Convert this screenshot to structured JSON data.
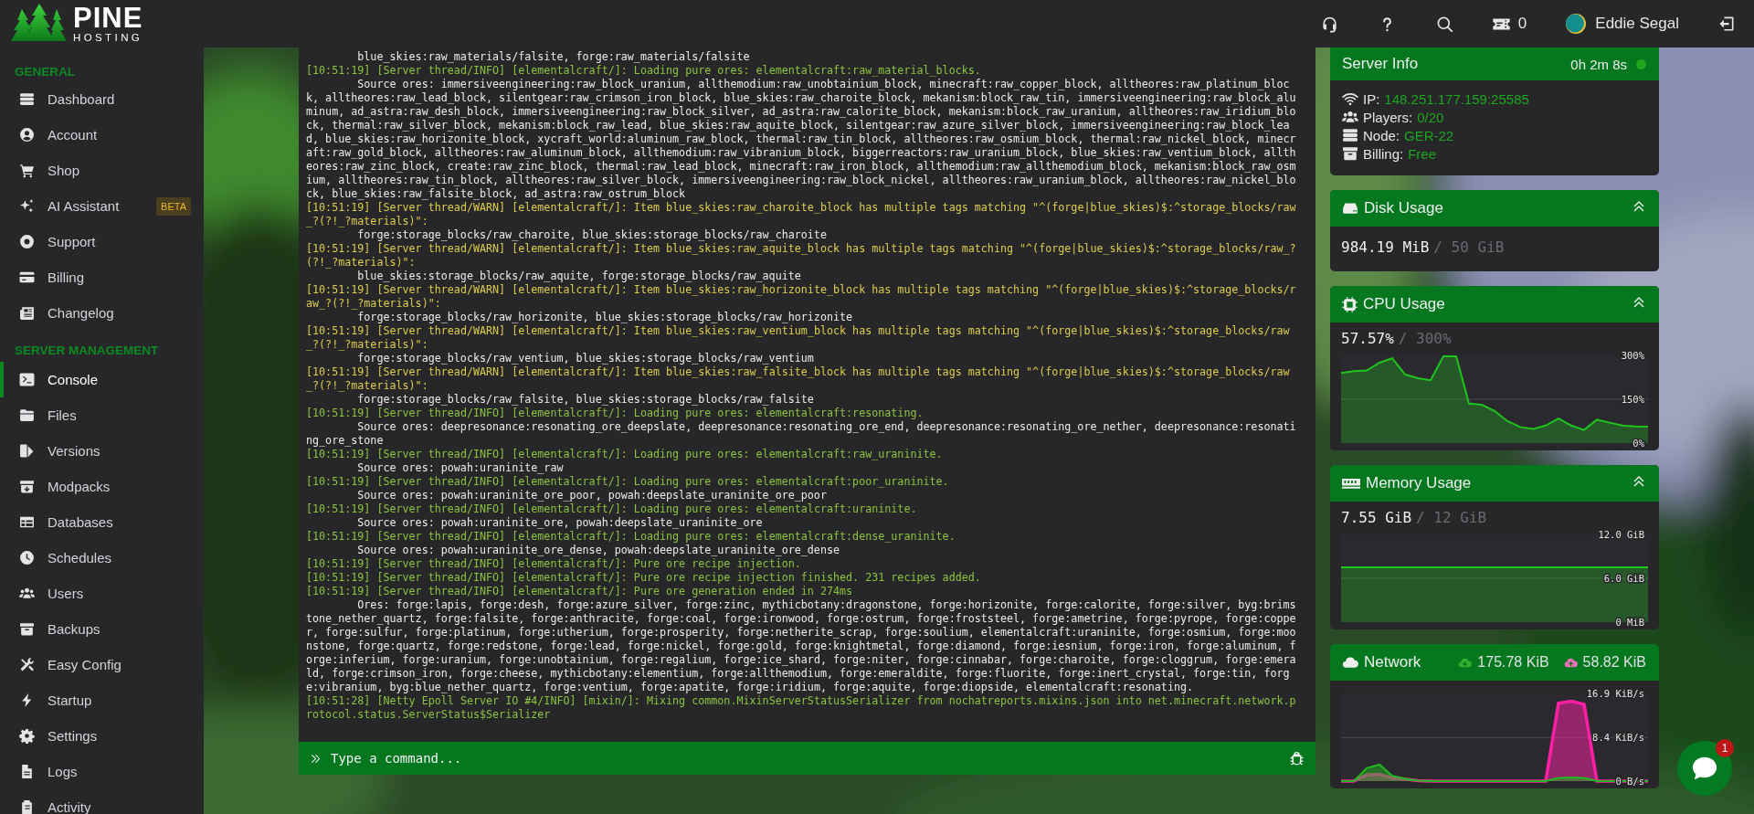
{
  "brand": {
    "name": "PINE",
    "tagline": "HOSTING"
  },
  "topbar": {
    "ticket_count": "0",
    "user_name": "Eddie Segal"
  },
  "sidebar": {
    "sections": [
      {
        "title": "GENERAL",
        "items": [
          {
            "label": "Dashboard",
            "selected": false
          },
          {
            "label": "Account",
            "selected": false
          },
          {
            "label": "Shop",
            "selected": false
          },
          {
            "label": "AI Assistant",
            "badge": "BETA",
            "selected": false
          },
          {
            "label": "Support",
            "selected": false
          },
          {
            "label": "Billing",
            "selected": false
          },
          {
            "label": "Changelog",
            "selected": false
          }
        ]
      },
      {
        "title": "SERVER MANAGEMENT",
        "items": [
          {
            "label": "Console",
            "selected": true
          },
          {
            "label": "Files",
            "selected": false
          },
          {
            "label": "Versions",
            "selected": false
          },
          {
            "label": "Modpacks",
            "selected": false
          },
          {
            "label": "Databases",
            "selected": false
          },
          {
            "label": "Schedules",
            "selected": false
          },
          {
            "label": "Users",
            "selected": false
          },
          {
            "label": "Backups",
            "selected": false
          },
          {
            "label": "Easy Config",
            "selected": false
          },
          {
            "label": "Startup",
            "selected": false
          },
          {
            "label": "Settings",
            "selected": false
          },
          {
            "label": "Logs",
            "selected": false
          },
          {
            "label": "Activity",
            "selected": false
          }
        ]
      }
    ]
  },
  "console": {
    "lines": [
      {
        "kind": "detail",
        "text": "blue_skies:raw_materials/falsite, forge:raw_materials/falsite"
      },
      {
        "kind": "info",
        "text": "[10:51:19] [Server thread/INFO] [elementalcraft/]: Loading pure ores: elementalcraft:raw_material_blocks."
      },
      {
        "kind": "detail",
        "text": "Source ores: immersiveengineering:raw_block_uranium, allthemodium:raw_unobtainium_block, minecraft:raw_copper_block, alltheores:raw_platinum_block, alltheores:raw_lead_block, silentgear:raw_crimson_iron_block, blue_skies:raw_charoite_block, mekanism:block_raw_tin, immersiveengineering:raw_block_aluminum, ad_astra:raw_desh_block, immersiveengineering:raw_block_silver, ad_astra:raw_calorite_block, mekanism:block_raw_uranium, alltheores:raw_iridium_block, thermal:raw_silver_block, mekanism:block_raw_lead, blue_skies:raw_aquite_block, silentgear:raw_azure_silver_block, immersiveengineering:raw_block_lead, blue_skies:raw_horizonite_block, xycraft_world:aluminum_raw_block, thermal:raw_tin_block, alltheores:raw_osmium_block, thermal:raw_nickel_block, minecraft:raw_gold_block, alltheores:raw_aluminum_block, allthemodium:raw_vibranium_block, biggerreactors:raw_uranium_block, blue_skies:raw_ventium_block, alltheores:raw_zinc_block, create:raw_zinc_block, thermal:raw_lead_block, minecraft:raw_iron_block, allthemodium:raw_allthemodium_block, mekanism:block_raw_osmium, alltheores:raw_tin_block, alltheores:raw_silver_block, immersiveengineering:raw_block_nickel, alltheores:raw_uranium_block, alltheores:raw_nickel_block, blue_skies:raw_falsite_block, ad_astra:raw_ostrum_block"
      },
      {
        "kind": "warn",
        "text": "[10:51:19] [Server thread/WARN] [elementalcraft/]: Item blue_skies:raw_charoite_block has multiple tags matching \"^(forge|blue_skies)$:^storage_blocks/raw_?(?!_?materials)\":"
      },
      {
        "kind": "detail",
        "text": "forge:storage_blocks/raw_charoite, blue_skies:storage_blocks/raw_charoite"
      },
      {
        "kind": "warn",
        "text": "[10:51:19] [Server thread/WARN] [elementalcraft/]: Item blue_skies:raw_aquite_block has multiple tags matching \"^(forge|blue_skies)$:^storage_blocks/raw_?(?!_?materials)\":"
      },
      {
        "kind": "detail",
        "text": "blue_skies:storage_blocks/raw_aquite, forge:storage_blocks/raw_aquite"
      },
      {
        "kind": "warn",
        "text": "[10:51:19] [Server thread/WARN] [elementalcraft/]: Item blue_skies:raw_horizonite_block has multiple tags matching \"^(forge|blue_skies)$:^storage_blocks/raw_?(?!_?materials)\":"
      },
      {
        "kind": "detail",
        "text": "forge:storage_blocks/raw_horizonite, blue_skies:storage_blocks/raw_horizonite"
      },
      {
        "kind": "warn",
        "text": "[10:51:19] [Server thread/WARN] [elementalcraft/]: Item blue_skies:raw_ventium_block has multiple tags matching \"^(forge|blue_skies)$:^storage_blocks/raw_?(?!_?materials)\":"
      },
      {
        "kind": "detail",
        "text": "forge:storage_blocks/raw_ventium, blue_skies:storage_blocks/raw_ventium"
      },
      {
        "kind": "warn",
        "text": "[10:51:19] [Server thread/WARN] [elementalcraft/]: Item blue_skies:raw_falsite_block has multiple tags matching \"^(forge|blue_skies)$:^storage_blocks/raw_?(?!_?materials)\":"
      },
      {
        "kind": "detail",
        "text": "forge:storage_blocks/raw_falsite, blue_skies:storage_blocks/raw_falsite"
      },
      {
        "kind": "info",
        "text": "[10:51:19] [Server thread/INFO] [elementalcraft/]: Loading pure ores: elementalcraft:resonating."
      },
      {
        "kind": "detail",
        "text": "Source ores: deepresonance:resonating_ore_deepslate, deepresonance:resonating_ore_end, deepresonance:resonating_ore_nether, deepresonance:resonating_ore_stone"
      },
      {
        "kind": "info",
        "text": "[10:51:19] [Server thread/INFO] [elementalcraft/]: Loading pure ores: elementalcraft:raw_uraninite."
      },
      {
        "kind": "detail",
        "text": "Source ores: powah:uraninite_raw"
      },
      {
        "kind": "info",
        "text": "[10:51:19] [Server thread/INFO] [elementalcraft/]: Loading pure ores: elementalcraft:poor_uraninite."
      },
      {
        "kind": "detail",
        "text": "Source ores: powah:uraninite_ore_poor, powah:deepslate_uraninite_ore_poor"
      },
      {
        "kind": "info",
        "text": "[10:51:19] [Server thread/INFO] [elementalcraft/]: Loading pure ores: elementalcraft:uraninite."
      },
      {
        "kind": "detail",
        "text": "Source ores: powah:uraninite_ore, powah:deepslate_uraninite_ore"
      },
      {
        "kind": "info",
        "text": "[10:51:19] [Server thread/INFO] [elementalcraft/]: Loading pure ores: elementalcraft:dense_uraninite."
      },
      {
        "kind": "detail",
        "text": "Source ores: powah:uraninite_ore_dense, powah:deepslate_uraninite_ore_dense"
      },
      {
        "kind": "info",
        "text": "[10:51:19] [Server thread/INFO] [elementalcraft/]: Pure ore recipe injection."
      },
      {
        "kind": "info",
        "text": "[10:51:19] [Server thread/INFO] [elementalcraft/]: Pure ore recipe injection finished. 231 recipes added."
      },
      {
        "kind": "info",
        "text": "[10:51:19] [Server thread/INFO] [elementalcraft/]: Pure ore generation ended in 274ms"
      },
      {
        "kind": "detail",
        "text": "Ores: forge:lapis, forge:desh, forge:azure_silver, forge:zinc, mythicbotany:dragonstone, forge:horizonite, forge:calorite, forge:silver, byg:brimstone_nether_quartz, forge:falsite, forge:anthracite, forge:coal, forge:ironwood, forge:ostrum, forge:froststeel, forge:ametrine, forge:pyrope, forge:copper, forge:sulfur, forge:platinum, forge:utherium, forge:prosperity, forge:netherite_scrap, forge:soulium, elementalcraft:uraninite, forge:osmium, forge:moonstone, forge:quartz, forge:redstone, forge:lead, forge:nickel, forge:gold, forge:knightmetal, forge:diamond, forge:iesnium, forge:iron, forge:aluminum, forge:inferium, forge:uranium, forge:unobtainium, forge:regalium, forge:ice_shard, forge:niter, forge:cinnabar, forge:charoite, forge:cloggrum, forge:emerald, forge:crimson_iron, forge:cheese, mythicbotany:elementium, forge:allthemodium, forge:emeraldite, forge:fluorite, forge:inert_crystal, forge:tin, forge:vibranium, byg:blue_nether_quartz, forge:ventium, forge:apatite, forge:iridium, forge:aquite, forge:diopside, elementalcraft:resonating."
      },
      {
        "kind": "info",
        "text": "[10:51:28] [Netty Epoll Server IO #4/INFO] [mixin/]: Mixing common.MixinServerStatusSerializer from nochatreports.mixins.json into net.minecraft.network.protocol.status.ServerStatus$Serializer"
      }
    ],
    "input": {
      "placeholder": "Type a command..."
    }
  },
  "server_info": {
    "title": "Server Info",
    "uptime": "0h 2m 8s",
    "online": true,
    "rows": [
      {
        "label": "IP:",
        "value": "148.251.177.159:25585"
      },
      {
        "label": "Players:",
        "value": "0/20"
      },
      {
        "label": "Node:",
        "value": "GER-22"
      },
      {
        "label": "Billing:",
        "value": "Free"
      }
    ]
  },
  "disk": {
    "title": "Disk Usage",
    "used": "984.19 MiB",
    "total": "/ 50 GiB"
  },
  "cpu": {
    "title": "CPU Usage",
    "used": "57.57%",
    "total": "/ 300%",
    "chart_data": {
      "type": "area",
      "ylim": [
        0,
        300
      ],
      "yticks": [
        {
          "value": 300,
          "label": "300%"
        },
        {
          "value": 150,
          "label": "150%"
        },
        {
          "value": 0,
          "label": "0%"
        }
      ],
      "values": [
        240,
        246,
        248,
        275,
        290,
        235,
        222,
        215,
        300,
        300,
        135,
        131,
        110,
        75,
        55,
        48,
        60,
        84,
        60,
        45,
        80,
        70,
        60,
        57,
        56
      ]
    }
  },
  "memory": {
    "title": "Memory Usage",
    "used": "7.55 GiB",
    "total": "/ 12 GiB",
    "chart_data": {
      "type": "area",
      "ylim": [
        0,
        12
      ],
      "yticks": [
        {
          "value": 12,
          "label": "12.0 GiB"
        },
        {
          "value": 6,
          "label": "6.0 GiB"
        },
        {
          "value": 0,
          "label": "0 MiB"
        }
      ],
      "values": [
        7.5,
        7.5,
        7.5,
        7.5,
        7.5,
        7.5,
        7.5,
        7.5,
        7.5,
        7.5,
        7.5,
        7.5,
        7.5,
        7.5,
        7.5,
        7.5,
        7.5,
        7.5,
        7.5,
        7.5,
        7.5,
        7.5,
        7.5,
        7.5,
        7.5
      ]
    }
  },
  "network": {
    "title": "Network",
    "download": "175.78 KiB",
    "upload": "58.82 KiB",
    "chart_data": {
      "type": "area",
      "ylim": [
        0,
        16.9
      ],
      "yticks": [
        {
          "value": 16.9,
          "label": "16.9 KiB/s"
        },
        {
          "value": 8.4,
          "label": "8.4 KiB/s"
        },
        {
          "value": 0,
          "label": "0 B/s"
        }
      ],
      "series": [
        {
          "color": "#22b822",
          "values": [
            0,
            0,
            2.5,
            3.2,
            1.0,
            0.5,
            0.1,
            0,
            0,
            0,
            0,
            0,
            0,
            0,
            0,
            0,
            0,
            0.6,
            0.7,
            0.6,
            0,
            0,
            0,
            0,
            0
          ]
        },
        {
          "color": "#ff1fa5",
          "values": [
            0,
            0,
            1.2,
            1.3,
            0.6,
            0.4,
            0.1,
            0,
            0,
            0,
            0,
            0,
            0,
            0,
            0,
            0,
            0,
            15.0,
            15.4,
            14.8,
            0,
            0,
            0,
            0,
            0
          ]
        }
      ]
    }
  },
  "chat": {
    "unread": "1"
  }
}
